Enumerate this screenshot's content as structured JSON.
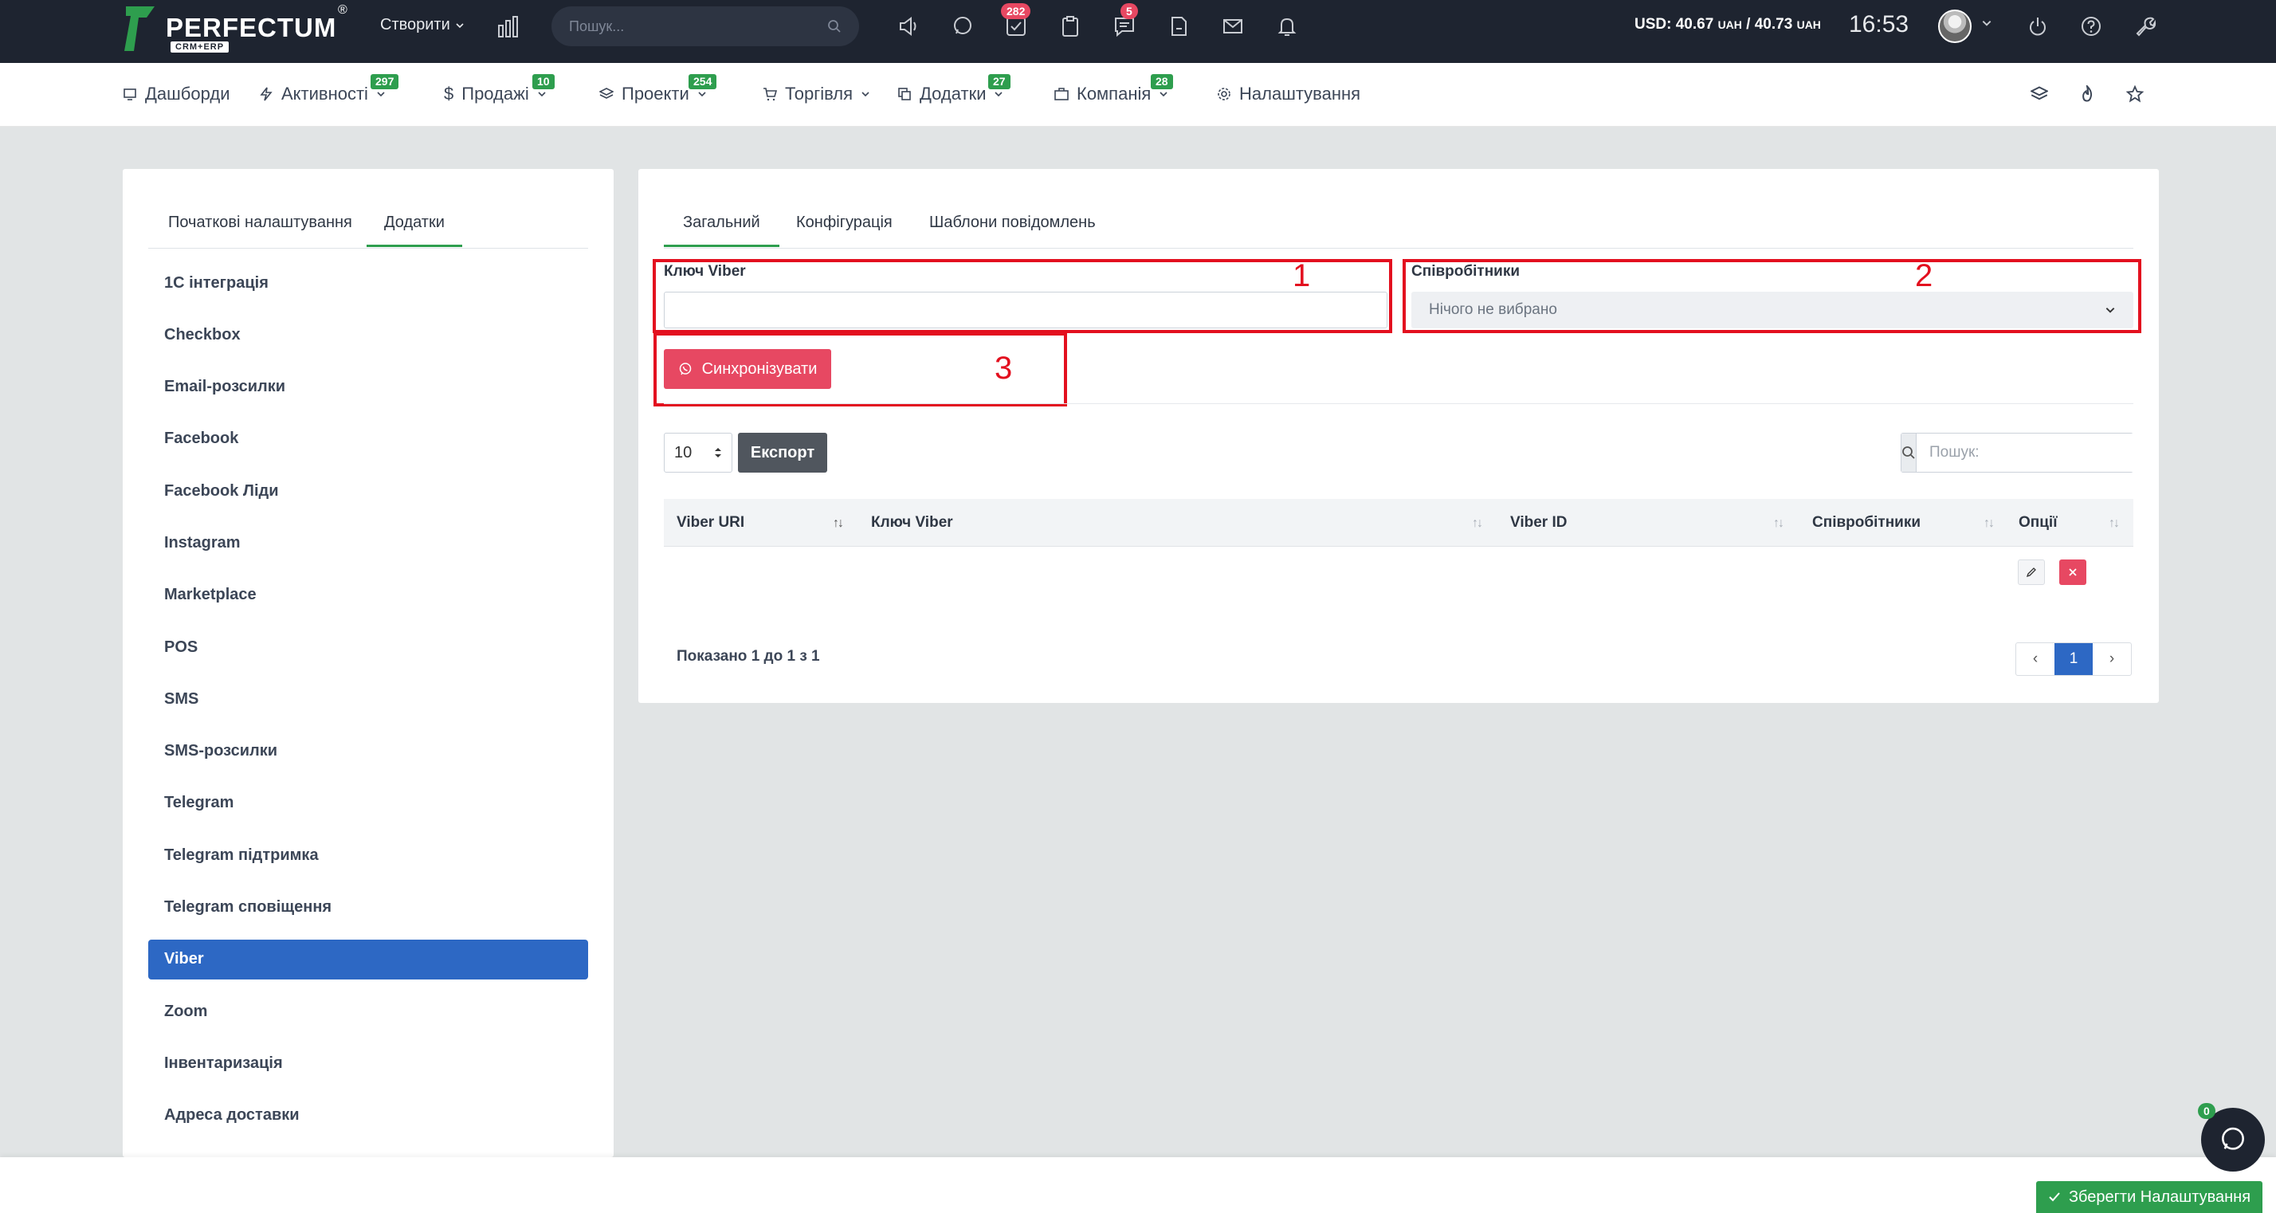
{
  "topbar": {
    "logo_text": "PERFECTUM",
    "logo_sub": "CRM+ERP",
    "logo_reg": "®",
    "create_label": "Створити",
    "search_placeholder": "Пошук...",
    "tasks_badge": "282",
    "messages_badge": "5",
    "currency_usd_label": "USD: 40.67",
    "currency_uah1": "UAH",
    "currency_sep": " / 40.73",
    "currency_uah2": "UAH",
    "clock": "16:53"
  },
  "nav": {
    "items": [
      {
        "label": "Дашборди",
        "badge": ""
      },
      {
        "label": "Активності",
        "badge": "297"
      },
      {
        "label": "Продажі",
        "badge": "10"
      },
      {
        "label": "Проекти",
        "badge": "254"
      },
      {
        "label": "Торгівля",
        "badge": ""
      },
      {
        "label": "Додатки",
        "badge": "27"
      },
      {
        "label": "Компанія",
        "badge": "28"
      },
      {
        "label": "Налаштування",
        "badge": ""
      }
    ]
  },
  "left_panel": {
    "tabs": [
      "Початкові налаштування",
      "Додатки"
    ],
    "items": [
      "1С інтеграція",
      "Checkbox",
      "Email-розсилки",
      "Facebook",
      "Facebook Ліди",
      "Instagram",
      "Marketplace",
      "POS",
      "SMS",
      "SMS-розсилки",
      "Telegram",
      "Telegram підтримка",
      "Telegram сповіщення",
      "Viber",
      "Zoom",
      "Інвентаризація",
      "Адреса доставки"
    ],
    "active_item": "Viber"
  },
  "right_panel": {
    "tabs": [
      "Загальний",
      "Конфігурація",
      "Шаблони повідомлень"
    ],
    "viber_key_label": "Ключ Viber",
    "viber_key_value": "",
    "employees_label": "Співробітники",
    "employees_value": "Нічого не вибрано",
    "sync_label": "Синхронізувати",
    "annotations": [
      "1",
      "2",
      "3"
    ],
    "page_size": "10",
    "export_label": "Експорт",
    "search_placeholder": "Пошук:",
    "columns": [
      "Viber URI",
      "Ключ Viber",
      "Viber ID",
      "Співробітники",
      "Опції"
    ],
    "info": "Показано 1 до 1 з 1",
    "pager": {
      "prev": "‹",
      "current": "1",
      "next": "›"
    }
  },
  "footer": {
    "save_label": "Зберегти Налаштування",
    "chat_count": "0"
  },
  "colors": {
    "topbar": "#1e2430",
    "accent_green": "#2e9e4e",
    "accent_blue": "#2d68c4",
    "danger": "#e74862",
    "annotation_red": "#e3101f"
  }
}
